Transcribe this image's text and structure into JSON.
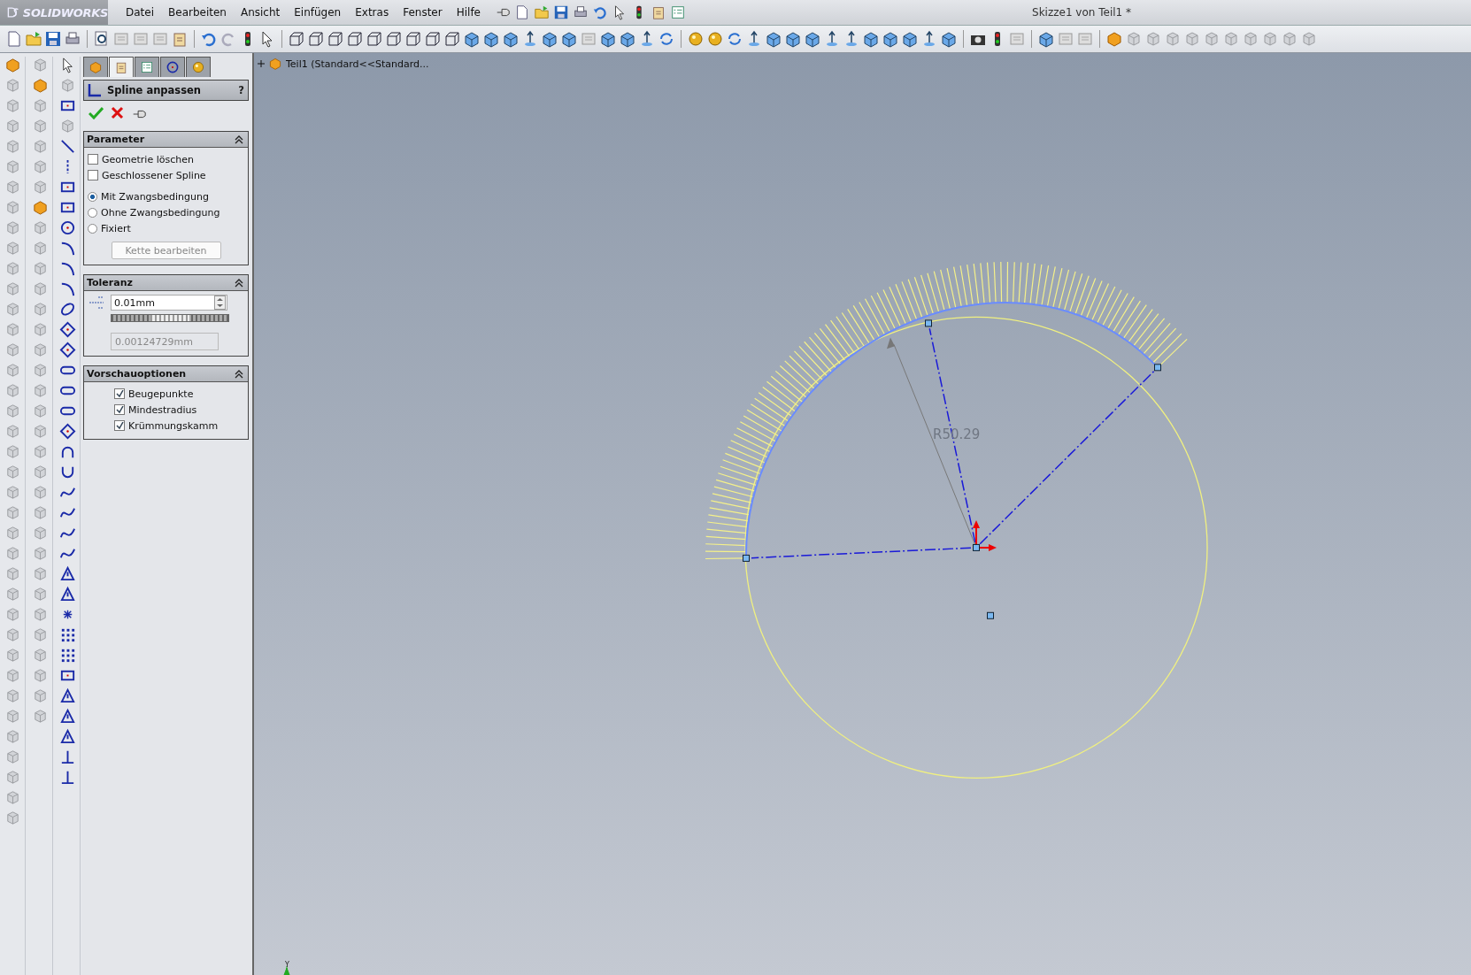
{
  "menu_bar": {
    "logo": "SOLIDWORKS",
    "items": [
      "Datei",
      "Bearbeiten",
      "Ansicht",
      "Einfügen",
      "Extras",
      "Fenster",
      "Hilfe"
    ]
  },
  "window": {
    "title": "Skizze1 von Teil1 *"
  },
  "property_manager": {
    "tabs": [
      {
        "selected": false
      },
      {
        "selected": true
      },
      {
        "selected": false
      },
      {
        "selected": false
      },
      {
        "selected": false
      }
    ],
    "title": "Spline anpassen",
    "help": "?",
    "sections": [
      {
        "kind": "parameter",
        "title": "Parameter",
        "expanded": true,
        "checkboxes": [
          {
            "label": "Geometrie löschen",
            "checked": false
          },
          {
            "label": "Geschlossener Spline",
            "checked": false
          }
        ],
        "radios": [
          {
            "label": "Mit Zwangsbedingung",
            "selected": true
          },
          {
            "label": "Ohne Zwangsbedingung",
            "selected": false
          },
          {
            "label": "Fixiert",
            "selected": false
          }
        ],
        "button": {
          "label": "Kette bearbeiten",
          "disabled": true
        }
      },
      {
        "kind": "tolerance",
        "title": "Toleranz",
        "expanded": true,
        "value": "0.01mm",
        "level": 0.5,
        "result": "0.00124729mm"
      },
      {
        "kind": "preview",
        "title": "Vorschauoptionen",
        "expanded": true,
        "checkboxes": [
          {
            "label": "Beugepunkte",
            "checked": true
          },
          {
            "label": "Mindestradius",
            "checked": true
          },
          {
            "label": "Krümmungskamm",
            "checked": true
          }
        ]
      }
    ]
  },
  "tree": {
    "label": "Teil1  (Standard<<Standard...",
    "expanded": false
  },
  "canvas": {
    "dimension": "R50.29",
    "axis_label": "Y"
  }
}
